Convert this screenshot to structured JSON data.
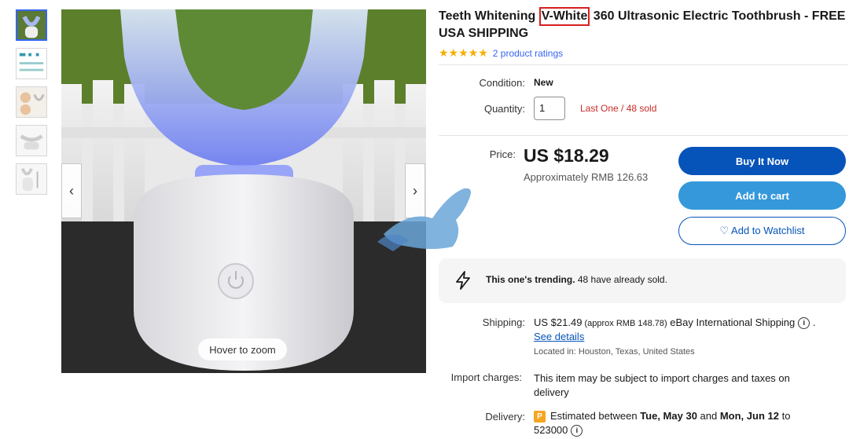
{
  "gallery": {
    "thumbnail_count": 5,
    "zoom_hint": "Hover to zoom",
    "prev_arrow": "‹",
    "next_arrow": "›"
  },
  "listing": {
    "title_before": "Teeth Whitening ",
    "title_highlight": "V-White",
    "title_after": " 360 Ultrasonic Electric Toothbrush - FREE USA SHIPPING",
    "stars": "★★★★★",
    "ratings_link": "2 product ratings"
  },
  "details": {
    "condition_label": "Condition:",
    "condition_value": "New",
    "quantity_label": "Quantity:",
    "quantity_value": "1",
    "stock_note": "Last One / 48 sold"
  },
  "pricing": {
    "price_label": "Price:",
    "price": "US $18.29",
    "approx": "Approximately RMB 126.63"
  },
  "actions": {
    "buy_now": "Buy It Now",
    "add_to_cart": "Add to cart",
    "watchlist": "♡ Add to Watchlist"
  },
  "trending": {
    "bold": "This one's trending.",
    "rest": " 48 have already sold."
  },
  "shipping": {
    "label": "Shipping:",
    "amount": "US $21.49",
    "approx": " (approx RMB 148.78)",
    "service": " eBay International Shipping",
    "info_icon": "i",
    "trailing": " .",
    "see_details": "See details",
    "location": "Located in: Houston, Texas, United States"
  },
  "import": {
    "label": "Import charges:",
    "text": "This item may be subject to import charges and taxes on delivery"
  },
  "delivery": {
    "label": "Delivery:",
    "badge": "P",
    "prefix": "Estimated between ",
    "date1": "Tue, May 30",
    "middle": " and ",
    "date2": "Mon, Jun 12",
    "suffix": " to 523000",
    "info_icon": "i"
  },
  "colors": {
    "buy_button": "#0654ba",
    "cart_button": "#3498db",
    "stars": "#f5af02",
    "stock_note": "#c62c28",
    "highlight_box": "#d6201f"
  }
}
